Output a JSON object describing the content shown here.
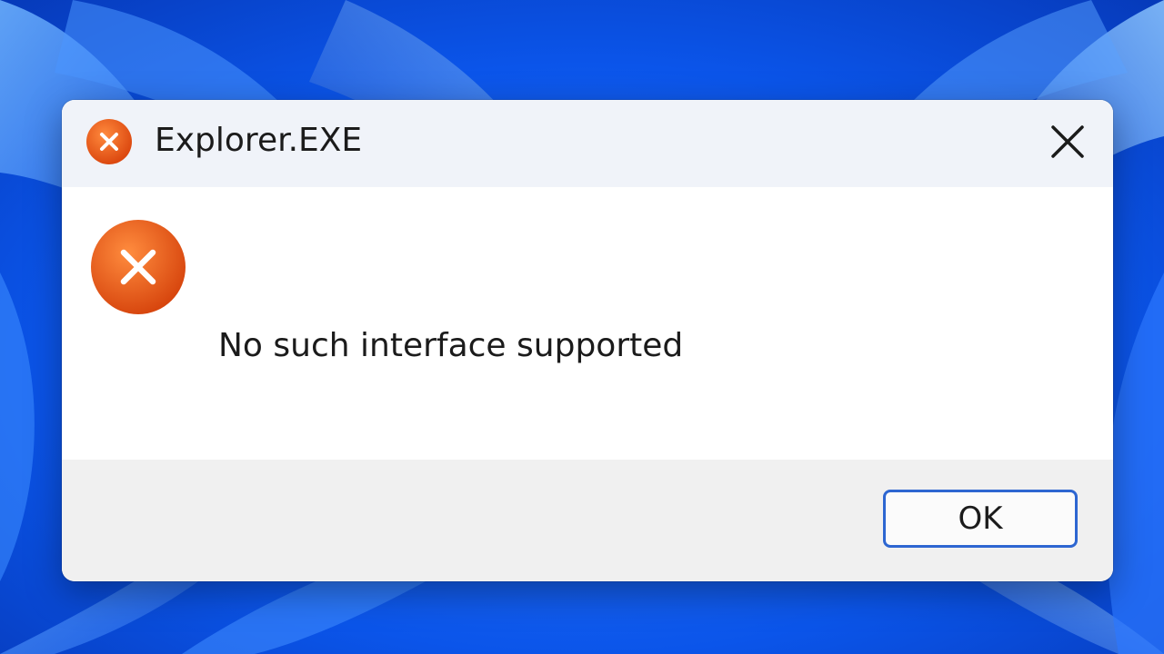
{
  "dialog": {
    "title": "Explorer.EXE",
    "message": "No such interface supported",
    "ok_label": "OK",
    "icon": "error-icon",
    "close_icon": "close-icon"
  },
  "colors": {
    "error_orange": "#e85a1e",
    "accent_blue": "#2d66d1",
    "wallpaper_blue": "#0a4fe6"
  }
}
